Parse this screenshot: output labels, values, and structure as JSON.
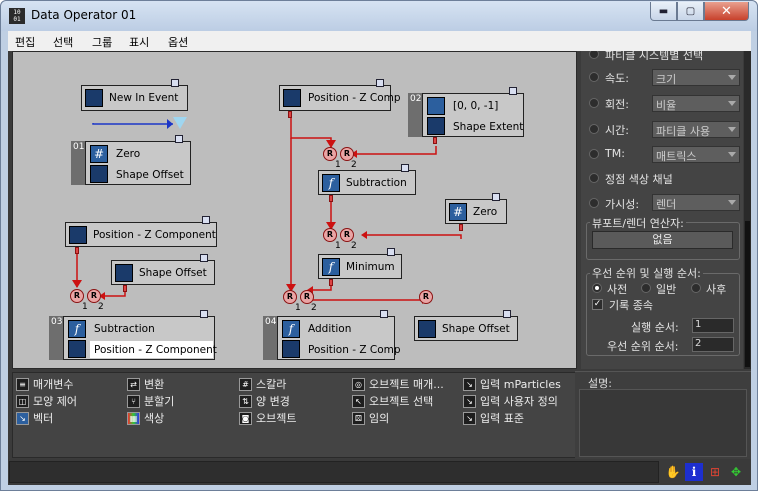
{
  "window": {
    "title": "Data Operator 01",
    "icon_text": "10\n01",
    "min_glyph": "▬",
    "max_glyph": "▢",
    "close_glyph": "✕"
  },
  "menu": [
    "편집",
    "선택",
    "그룹",
    "표시",
    "옵션"
  ],
  "nodes": {
    "new_in_event": "New In Event",
    "pos_z_comp_top": "Position - Z Comp",
    "zero01_idx": "01",
    "zero01_title": "Zero",
    "zero01_out": "Shape Offset",
    "vec02_idx": "02",
    "vec02_value": "[0, 0, -1]",
    "vec02_out": "Shape Extent",
    "subtraction_mid": "Subtraction",
    "zero_right": "Zero",
    "minimum": "Minimum",
    "pos_z_component": "Position - Z Component",
    "shape_offset_left": "Shape Offset",
    "sub03_idx": "03",
    "sub03_title": "Subtraction",
    "sub03_out": "Position - Z Component",
    "add04_idx": "04",
    "add04_title": "Addition",
    "add04_out": "Position - Z Comp",
    "shape_offset_right": "Shape Offset",
    "port_r": "R",
    "port_1": "1",
    "port_2": "2"
  },
  "panel": {
    "top_cut_label": "파티클 시스템별 선택",
    "speed_label": "속도:",
    "speed_value": "크기",
    "rotation_label": "회전:",
    "rotation_value": "비율",
    "time_label": "시간:",
    "time_value": "파티클 사용",
    "tm_label": "TM:",
    "tm_value": "매트릭스",
    "vertex_color": "정점 색상 채널",
    "visibility_label": "가시성:",
    "visibility_value": "렌더",
    "viewport_group": "뷰포트/렌더 연산자:",
    "viewport_button": "없음",
    "priority_group": "우선 순위 및 실행 순서:",
    "pre_label": "사전",
    "normal_label": "일반",
    "post_label": "사후",
    "record_label": "기록 종속",
    "exec_order_label": "실행 순서:",
    "exec_order_value": "1",
    "priority_order_label": "우선 순위 순서:",
    "priority_order_value": "2"
  },
  "palette": [
    {
      "label": "매개변수",
      "icon": "list-icon",
      "glyph": "≡"
    },
    {
      "label": "모양 제어",
      "icon": "shape-control-icon",
      "glyph": "◫"
    },
    {
      "label": "벡터",
      "icon": "vector-icon",
      "glyph": "↘"
    },
    {
      "label": "변환",
      "icon": "convert-icon",
      "glyph": "⇄"
    },
    {
      "label": "분할기",
      "icon": "splitter-icon",
      "glyph": "⑂"
    },
    {
      "label": "색상",
      "icon": "color-icon",
      "glyph": "▦"
    },
    {
      "label": "스칼라",
      "icon": "scalar-icon",
      "glyph": "#"
    },
    {
      "label": "양 변경",
      "icon": "amount-change-icon",
      "glyph": "⇅"
    },
    {
      "label": "오브젝트",
      "icon": "object-icon",
      "glyph": "◙"
    },
    {
      "label": "오브젝트 매개...",
      "icon": "object-param-icon",
      "glyph": "◎"
    },
    {
      "label": "오브젝트 선택",
      "icon": "object-select-icon",
      "glyph": "↖"
    },
    {
      "label": "임의",
      "icon": "random-icon",
      "glyph": "⚄"
    },
    {
      "label": "입력 mParticles",
      "icon": "input-mparticles-icon",
      "glyph": "↘"
    },
    {
      "label": "입력 사용자 정의",
      "icon": "input-custom-icon",
      "glyph": "↘"
    },
    {
      "label": "입력 표준",
      "icon": "input-standard-icon",
      "glyph": "↘"
    }
  ],
  "description_label": "설명:",
  "status_icons": {
    "hand": "✋",
    "info": "i",
    "grid": "⊞",
    "nav": "✥"
  }
}
